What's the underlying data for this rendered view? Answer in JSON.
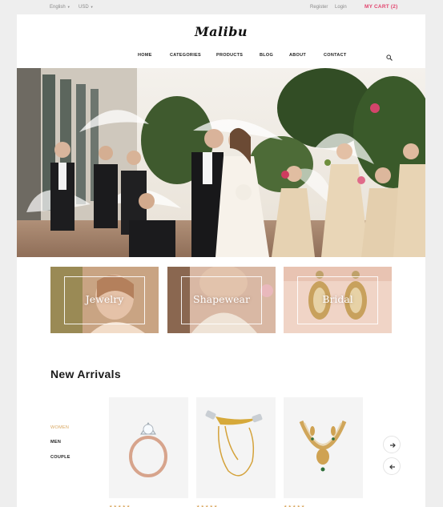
{
  "topbar": {
    "language": "English",
    "currency": "USD",
    "register": "Register",
    "login": "Login",
    "cart": "MY CART (2)"
  },
  "header": {
    "logo": "Malibu",
    "nav": [
      "HOME",
      "CATEGORIES",
      "PRODUCTS",
      "BLOG",
      "ABOUT",
      "CONTACT"
    ]
  },
  "categories": [
    {
      "label": "Jewelry"
    },
    {
      "label": "Shapewear"
    },
    {
      "label": "Bridal"
    }
  ],
  "arrivals": {
    "title": "New Arrivals",
    "filters": [
      "WOMEN",
      "MEN",
      "COUPLE"
    ],
    "active_filter": "WOMEN",
    "products": [
      {
        "icon": "ring-icon",
        "rating_stars": "★★★★★"
      },
      {
        "icon": "brooch-icon",
        "rating_stars": "★★★★★"
      },
      {
        "icon": "necklace-icon",
        "rating_stars": "★★★★★"
      }
    ]
  },
  "colors": {
    "accent": "#e2446e",
    "gold": "#d9a760",
    "background": "#eeeeee"
  }
}
